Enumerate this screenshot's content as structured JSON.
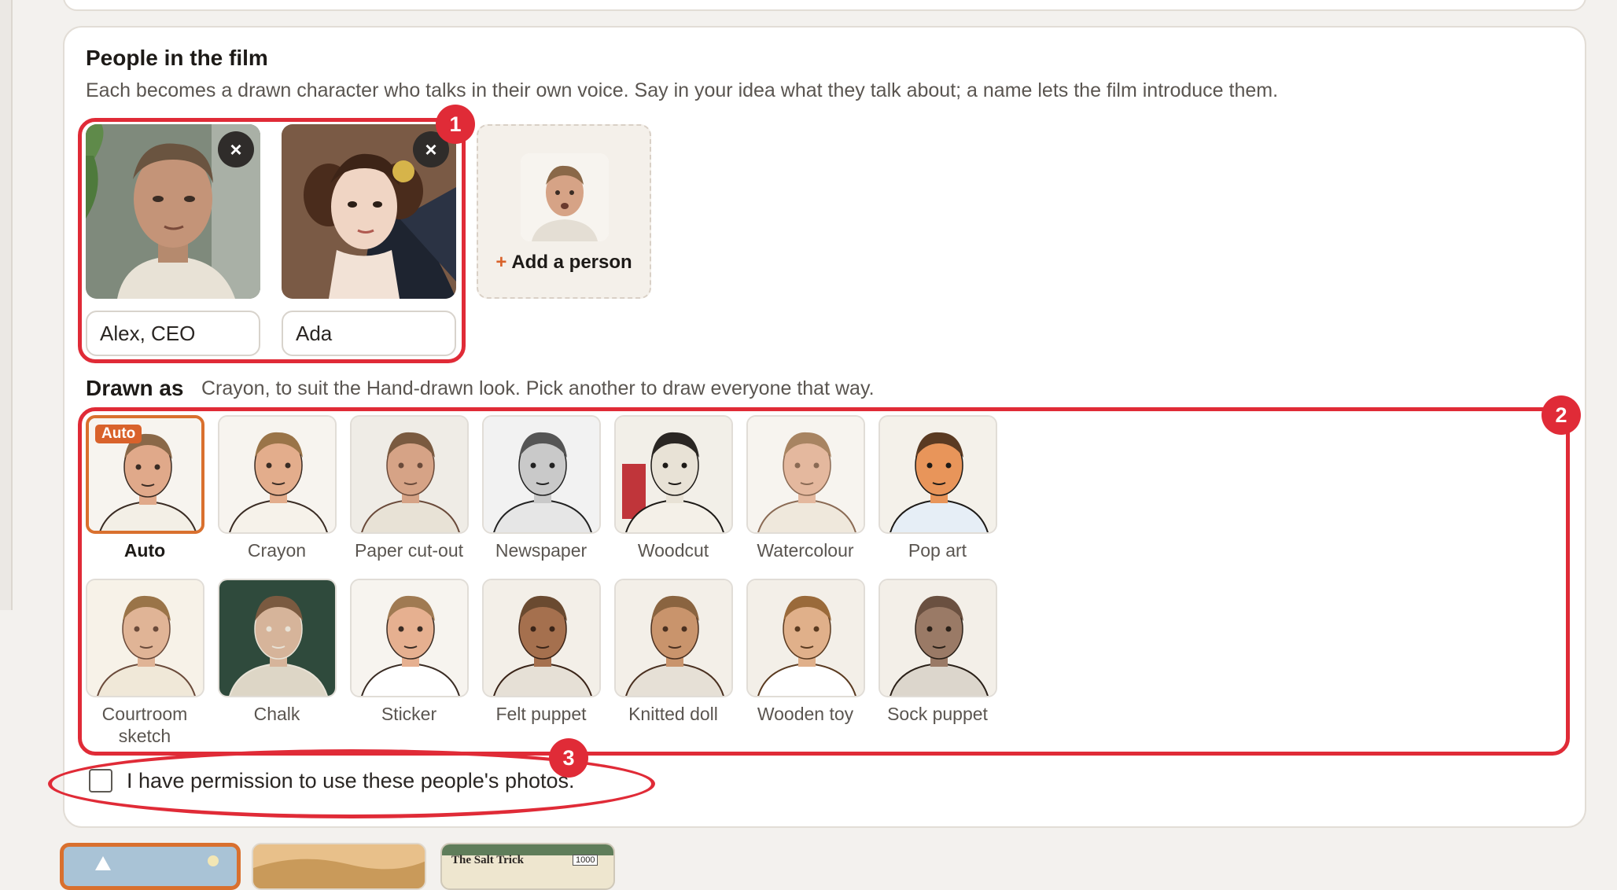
{
  "section": {
    "title": "People in the film",
    "description": "Each becomes a drawn character who talks in their own voice. Say in your idea what they talk about; a name lets the film introduce them."
  },
  "people": [
    {
      "name": "Alex, CEO",
      "remove_label": "×",
      "photo": "man-photo"
    },
    {
      "name": "Ada",
      "remove_label": "×",
      "photo": "victorian-portrait"
    }
  ],
  "add_person": {
    "plus": "+",
    "label": "Add a person"
  },
  "drawn_as": {
    "title": "Drawn as",
    "description": "Crayon, to suit the Hand-drawn look. Pick another to draw everyone that way."
  },
  "styles": [
    {
      "label": "Auto",
      "badge": "Auto",
      "selected": true
    },
    {
      "label": "Crayon"
    },
    {
      "label": "Paper cut-out"
    },
    {
      "label": "Newspaper"
    },
    {
      "label": "Woodcut"
    },
    {
      "label": "Watercolour"
    },
    {
      "label": "Pop art"
    },
    {
      "label": "Courtroom sketch"
    },
    {
      "label": "Chalk"
    },
    {
      "label": "Sticker"
    },
    {
      "label": "Felt puppet"
    },
    {
      "label": "Knitted doll"
    },
    {
      "label": "Wooden toy"
    },
    {
      "label": "Sock puppet"
    }
  ],
  "permission": {
    "label": "I have permission to use these people's photos.",
    "checked": false
  },
  "annotations": [
    "1",
    "2",
    "3"
  ],
  "bottom_thumbnail": {
    "text": "The Salt Trick",
    "counter": "1000"
  },
  "colors": {
    "accent": "#d9622b",
    "annotation": "#e02b37"
  }
}
